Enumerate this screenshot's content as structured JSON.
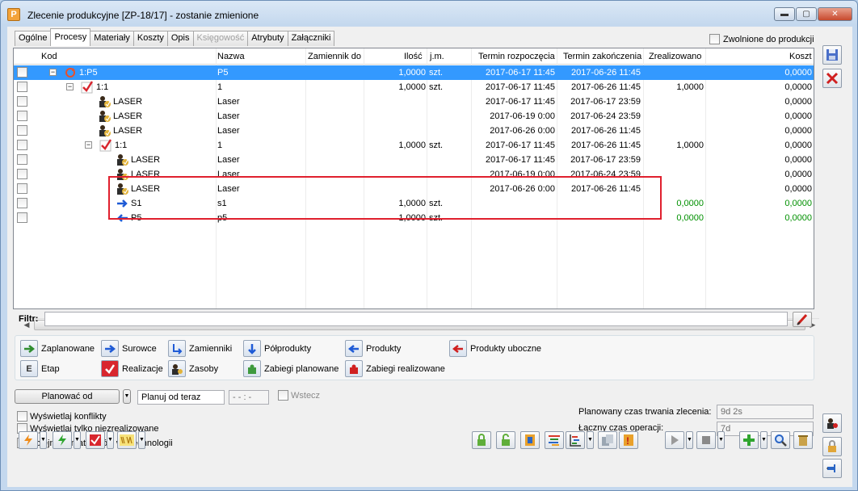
{
  "window": {
    "title": "Zlecenie produkcyjne  [ZP-18/17] - zostanie zmienione",
    "app_icon": "P"
  },
  "tabs": [
    {
      "label": "Ogólne"
    },
    {
      "label": "Procesy"
    },
    {
      "label": "Materiały"
    },
    {
      "label": "Koszty"
    },
    {
      "label": "Opis"
    },
    {
      "label": "Księgowość"
    },
    {
      "label": "Atrybuty"
    },
    {
      "label": "Załączniki"
    }
  ],
  "zwolnione_label": "Zwolnione do produkcji",
  "grid": {
    "headers": {
      "kod": "Kod",
      "nazwa": "Nazwa",
      "zamiennik": "Zamiennik do",
      "ilosc": "Ilość",
      "jm": "j.m.",
      "start": "Termin rozpoczęcia",
      "end": "Termin zakończenia",
      "zreal": "Zrealizowano",
      "koszt": "Koszt"
    },
    "rows": [
      {
        "kod": "1:P5",
        "nazwa": "P5",
        "ilosc": "1,0000",
        "jm": "szt.",
        "start": "2017-06-17 11:45",
        "end": "2017-06-26 11:45",
        "zreal": "",
        "koszt": "0,0000"
      },
      {
        "kod": "1:1",
        "nazwa": "1",
        "ilosc": "1,0000",
        "jm": "szt.",
        "start": "2017-06-17 11:45",
        "end": "2017-06-26 11:45",
        "zreal": "1,0000",
        "koszt": "0,0000"
      },
      {
        "kod": "LASER",
        "nazwa": "Laser",
        "ilosc": "",
        "jm": "",
        "start": "2017-06-17 11:45",
        "end": "2017-06-17 23:59",
        "zreal": "",
        "koszt": "0,0000"
      },
      {
        "kod": "LASER",
        "nazwa": "Laser",
        "ilosc": "",
        "jm": "",
        "start": "2017-06-19 0:00",
        "end": "2017-06-24 23:59",
        "zreal": "",
        "koszt": "0,0000"
      },
      {
        "kod": "LASER",
        "nazwa": "Laser",
        "ilosc": "",
        "jm": "",
        "start": "2017-06-26 0:00",
        "end": "2017-06-26 11:45",
        "zreal": "",
        "koszt": "0,0000"
      },
      {
        "kod": "1:1",
        "nazwa": "1",
        "ilosc": "1,0000",
        "jm": "szt.",
        "start": "2017-06-17 11:45",
        "end": "2017-06-26 11:45",
        "zreal": "1,0000",
        "koszt": "0,0000"
      },
      {
        "kod": "LASER",
        "nazwa": "Laser",
        "ilosc": "",
        "jm": "",
        "start": "2017-06-17 11:45",
        "end": "2017-06-17 23:59",
        "zreal": "",
        "koszt": "0,0000"
      },
      {
        "kod": "LASER",
        "nazwa": "Laser",
        "ilosc": "",
        "jm": "",
        "start": "2017-06-19 0:00",
        "end": "2017-06-24 23:59",
        "zreal": "",
        "koszt": "0,0000"
      },
      {
        "kod": "LASER",
        "nazwa": "Laser",
        "ilosc": "",
        "jm": "",
        "start": "2017-06-26 0:00",
        "end": "2017-06-26 11:45",
        "zreal": "",
        "koszt": "0,0000"
      },
      {
        "kod": "S1",
        "nazwa": "s1",
        "ilosc": "1,0000",
        "jm": "szt.",
        "start": "",
        "end": "",
        "zreal": "0,0000",
        "koszt": "0,0000"
      },
      {
        "kod": "P5",
        "nazwa": "p5",
        "ilosc": "1,0000",
        "jm": "szt.",
        "start": "",
        "end": "",
        "zreal": "0,0000",
        "koszt": "0,0000"
      }
    ]
  },
  "filtr_label": "Filtr:",
  "legend": {
    "zaplanowane": "Zaplanowane",
    "surowce": "Surowce",
    "zamienniki": "Zamienniki",
    "polprodukty": "Półprodukty",
    "produkty": "Produkty",
    "produkty_uboczne": "Produkty uboczne",
    "etap": "Etap",
    "realizacje": "Realizacje",
    "zasoby": "Zasoby",
    "zabiegi_planowane": "Zabiegi planowane",
    "zabiegi_realizowane": "Zabiegi realizowane",
    "etap_glyph": "E"
  },
  "planning": {
    "button": "Planować od",
    "planuj_value": "Planuj od teraz",
    "time_value": "- - : -",
    "wstecz": "Wstecz"
  },
  "options": {
    "konflikty": "Wyświetlaj konflikty",
    "niezrealizowane": "Wyświetlaj tylko niezrealizowane",
    "kolejnosc": "Kolejność materiałów wg technologii"
  },
  "summary": {
    "planowany_label": "Planowany czas trwania zlecenia:",
    "planowany_value": "9d 2s",
    "laczny_label": "Łączny czas operacji:",
    "laczny_value": "7d"
  },
  "colors": {
    "selection": "#3399ff",
    "highlight": "#e0202e",
    "green": "#009000"
  }
}
